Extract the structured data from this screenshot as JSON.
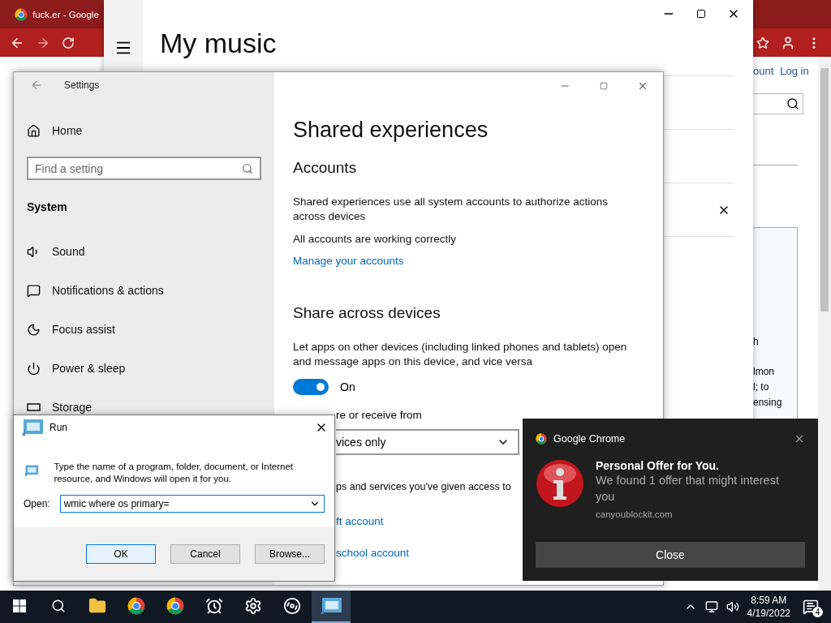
{
  "browser": {
    "tab_title": "fuck.er - Google",
    "account_link": "ount",
    "login_link": "Log in",
    "fragments": [
      "h",
      "lmon",
      "l; to",
      "ensing"
    ]
  },
  "music_window": {
    "title": "My music"
  },
  "settings": {
    "title": "Settings",
    "home": "Home",
    "search_placeholder": "Find a setting",
    "section": "System",
    "nav_items": [
      {
        "label": "Sound",
        "kind": "sound"
      },
      {
        "label": "Notifications & actions",
        "kind": "notifications"
      },
      {
        "label": "Focus assist",
        "kind": "focus"
      },
      {
        "label": "Power & sleep",
        "kind": "power"
      },
      {
        "label": "Storage",
        "kind": "storage"
      }
    ],
    "page_title": "Shared experiences",
    "accounts_heading": "Accounts",
    "accounts_text": "Shared experiences use all system accounts to authorize actions across devices",
    "accounts_status": "All accounts are working correctly",
    "manage_link": "Manage your accounts",
    "share_heading": "Share across devices",
    "share_text": "Let apps on other devices (including linked phones and tablets) open and message apps on this device, and vice versa",
    "toggle": {
      "on": true,
      "label": "On"
    },
    "share_from_label": "re or receive from",
    "share_from_value": "vices only",
    "access_text": "ps and services you've given access to",
    "links": [
      "ft account",
      "school account"
    ]
  },
  "run_dialog": {
    "title": "Run",
    "description": "Type the name of a program, folder, document, or Internet resource, and Windows will open it for you.",
    "open_label": "Open:",
    "value": "wmic where os primary=",
    "buttons": [
      {
        "label": "OK",
        "default": true
      },
      {
        "label": "Cancel",
        "default": false
      },
      {
        "label": "Browse...",
        "default": false
      }
    ]
  },
  "notification": {
    "app": "Google Chrome",
    "title": "Personal Offer for You.",
    "body": "We found 1 offer that might interest you",
    "source": "canyoublockit.com",
    "button": "Close"
  },
  "taskbar": {
    "apps": [
      {
        "kind": "explorer",
        "active": false
      },
      {
        "kind": "chrome",
        "active": false
      },
      {
        "kind": "chrome",
        "active": false
      },
      {
        "kind": "alarms",
        "active": false
      },
      {
        "kind": "settings",
        "active": false
      },
      {
        "kind": "groove",
        "active": false
      },
      {
        "kind": "run",
        "active": true
      }
    ],
    "time": "8:59 AM",
    "date": "4/19/2022",
    "notification_count": "4"
  }
}
